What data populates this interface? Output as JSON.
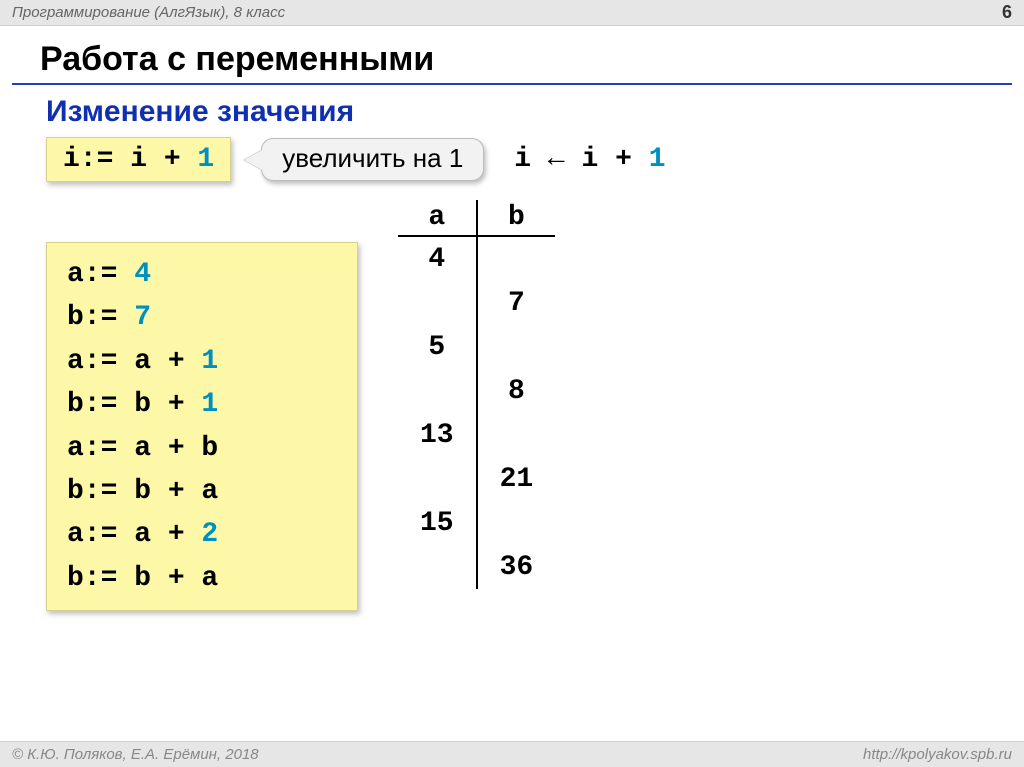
{
  "header": {
    "course": "Программирование (АлгЯзык), 8 класс",
    "page_number": "6"
  },
  "title": "Работа с переменными",
  "subtitle": "Изменение значения",
  "example": {
    "code": {
      "pre": "i:= i + ",
      "num": "1"
    },
    "callout": "увеличить на 1",
    "pseudo": {
      "pre": "i ← i + ",
      "num": "1"
    }
  },
  "code_block": [
    {
      "pre": "a:= ",
      "num": "4",
      "post": ""
    },
    {
      "pre": "b:= ",
      "num": "7",
      "post": ""
    },
    {
      "pre": "a:= a + ",
      "num": "1",
      "post": ""
    },
    {
      "pre": "b:= b + ",
      "num": "1",
      "post": ""
    },
    {
      "pre": "a:= a + b",
      "num": "",
      "post": ""
    },
    {
      "pre": "b:= b + a",
      "num": "",
      "post": ""
    },
    {
      "pre": "a:= a + ",
      "num": "2",
      "post": ""
    },
    {
      "pre": "b:= b + a",
      "num": "",
      "post": ""
    }
  ],
  "trace": {
    "headers": {
      "a": "a",
      "b": "b"
    },
    "rows": [
      {
        "a": "4",
        "b": ""
      },
      {
        "a": "",
        "b": "7"
      },
      {
        "a": "5",
        "b": ""
      },
      {
        "a": "",
        "b": "8"
      },
      {
        "a": "13",
        "b": ""
      },
      {
        "a": "",
        "b": "21"
      },
      {
        "a": "15",
        "b": ""
      },
      {
        "a": "",
        "b": "36"
      }
    ]
  },
  "footer": {
    "copyright": "© К.Ю. Поляков, Е.А. Ерёмин, 2018",
    "url": "http://kpolyakov.spb.ru"
  }
}
